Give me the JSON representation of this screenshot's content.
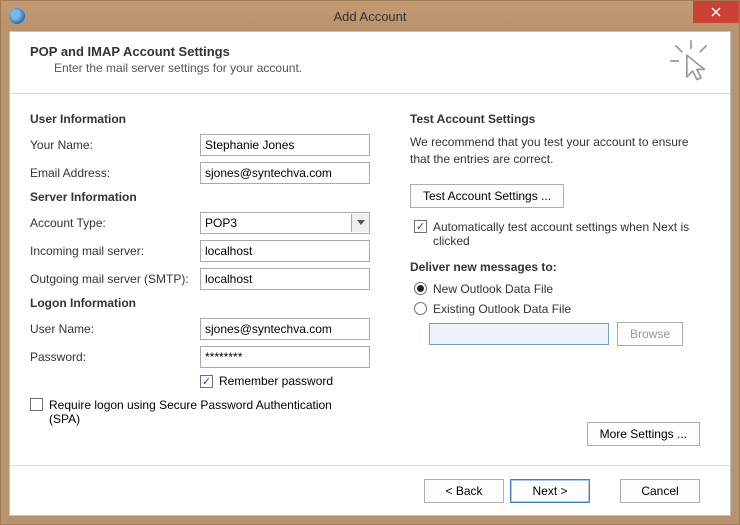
{
  "window": {
    "title": "Add Account"
  },
  "header": {
    "title": "POP and IMAP Account Settings",
    "subtitle": "Enter the mail server settings for your account."
  },
  "sections": {
    "user_info": "User Information",
    "server_info": "Server Information",
    "logon_info": "Logon Information",
    "test_settings": "Test Account Settings",
    "deliver_to": "Deliver new messages to:"
  },
  "labels": {
    "your_name": "Your Name:",
    "email_address": "Email Address:",
    "account_type": "Account Type:",
    "incoming": "Incoming mail server:",
    "outgoing": "Outgoing mail server (SMTP):",
    "user_name": "User Name:",
    "password": "Password:",
    "remember_password": "Remember password",
    "require_spa": "Require logon using Secure Password Authentication (SPA)",
    "auto_test": "Automatically test account settings when Next is clicked",
    "new_data_file": "New Outlook Data File",
    "existing_data_file": "Existing Outlook Data File"
  },
  "values": {
    "your_name": "Stephanie Jones",
    "email_address": "sjones@syntechva.com",
    "account_type": "POP3",
    "incoming": "localhost",
    "outgoing": "localhost",
    "user_name": "sjones@syntechva.com",
    "password": "********"
  },
  "test": {
    "description": "We recommend that you test your account to ensure that the entries are correct.",
    "test_button": "Test Account Settings ..."
  },
  "buttons": {
    "browse": "Browse",
    "more_settings": "More Settings ...",
    "back": "< Back",
    "next": "Next >",
    "cancel": "Cancel"
  }
}
